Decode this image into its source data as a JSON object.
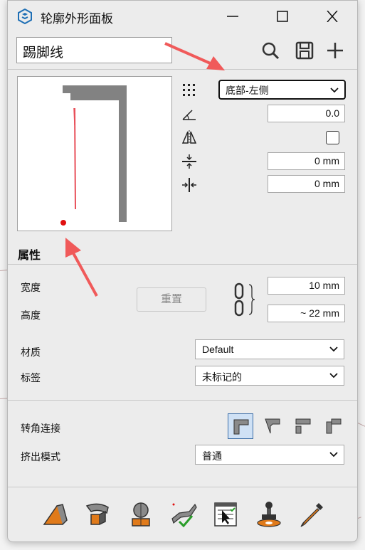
{
  "window": {
    "title": "轮廓外形面板"
  },
  "toolbar": {
    "profile_name": "踢脚线",
    "icons": [
      "search-icon",
      "save-icon",
      "add-icon"
    ]
  },
  "placement": {
    "anchor_value": "底部-左侧",
    "rotation_value": "0.0",
    "flip_checked": false,
    "offset_x_value": "0 mm",
    "offset_y_value": "0 mm"
  },
  "properties": {
    "section_title": "属性",
    "width_label": "宽度",
    "height_label": "高度",
    "width_value": "10 mm",
    "height_value": "~ 22 mm",
    "reset_label": "重置",
    "material_label": "材质",
    "material_value": "Default",
    "tag_label": "标签",
    "tag_value": "未标记的"
  },
  "joint": {
    "corner_label": "转角连接",
    "extrude_label": "挤出模式",
    "extrude_value": "普通"
  },
  "colors": {
    "accent_red": "#e8505a",
    "selected_border": "#3d6ea7",
    "selected_bg": "#cfe1f5"
  },
  "bottom_tools": [
    "extrude-icon",
    "follow-path-icon",
    "revolve-icon",
    "path-edit-icon",
    "selection-list-icon",
    "stamp-icon",
    "eyedropper-icon"
  ]
}
